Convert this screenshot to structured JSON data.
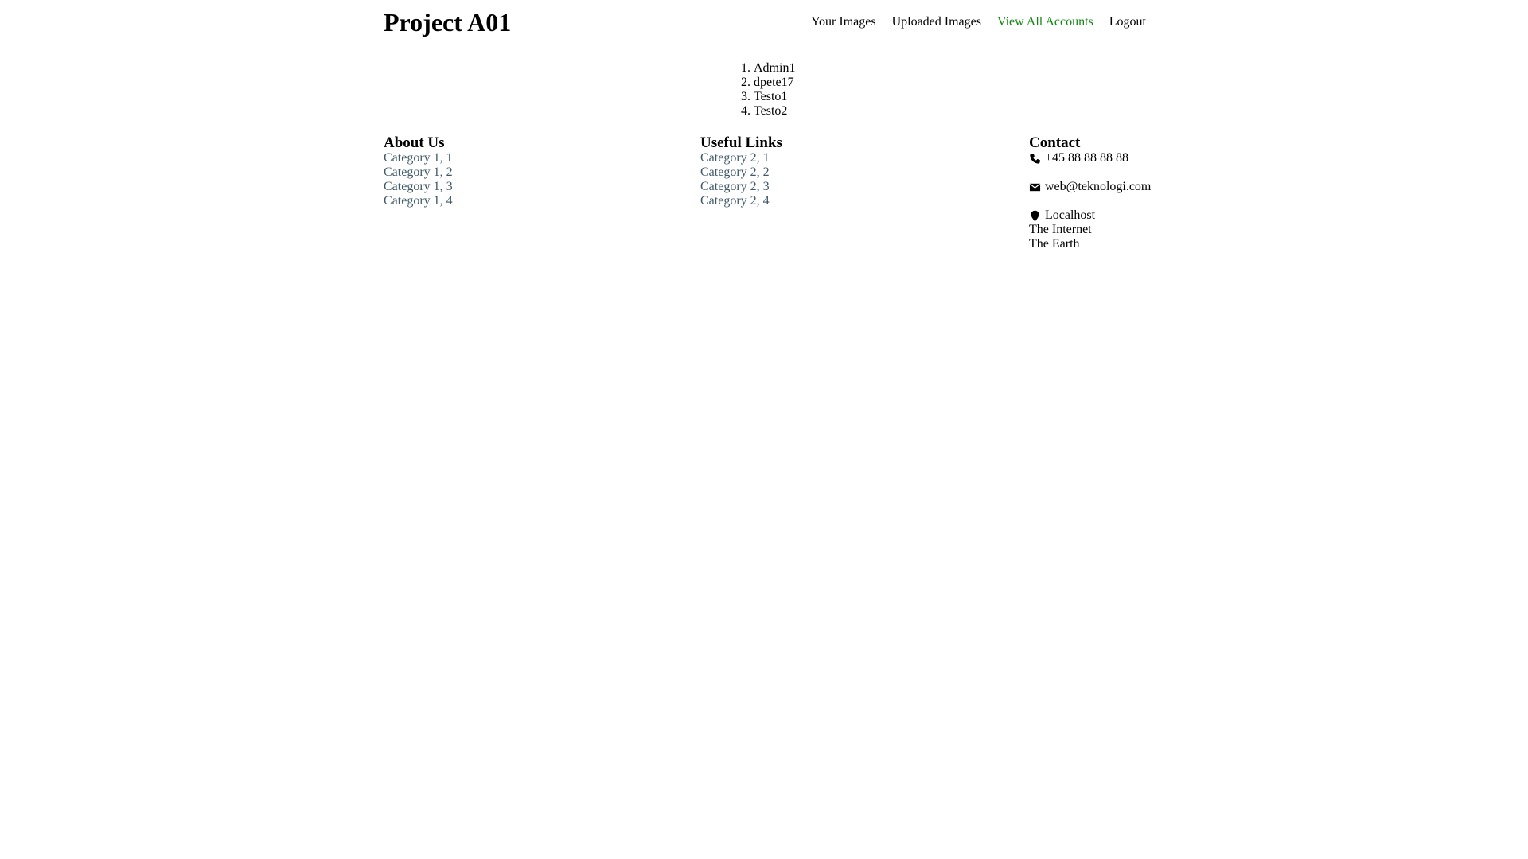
{
  "header": {
    "title": "Project A01",
    "nav": [
      {
        "label": "Your Images",
        "active": false
      },
      {
        "label": "Uploaded Images",
        "active": false
      },
      {
        "label": "View All Accounts",
        "active": true
      },
      {
        "label": "Logout",
        "active": false
      }
    ]
  },
  "accounts": {
    "items": [
      "Admin1",
      "dpete17",
      "Testo1",
      "Testo2"
    ]
  },
  "footer": {
    "about": {
      "heading": "About Us",
      "links": [
        "Category 1, 1",
        "Category 1, 2",
        "Category 1, 3",
        "Category 1, 4"
      ]
    },
    "useful": {
      "heading": "Useful Links",
      "links": [
        "Category 2, 1",
        "Category 2, 2",
        "Category 2, 3",
        "Category 2, 4"
      ]
    },
    "contact": {
      "heading": "Contact",
      "phone": "+45 88 88 88 88",
      "email": "web@teknologi.com",
      "address": [
        "Localhost",
        "The Internet",
        "The Earth"
      ],
      "icons": {
        "phone": "phone-icon",
        "email": "envelope-icon",
        "address": "map-marker-icon"
      }
    }
  },
  "colors": {
    "active_nav": "#138713",
    "footer_link": "#3f5a66",
    "text": "#000000",
    "background": "#ffffff"
  }
}
